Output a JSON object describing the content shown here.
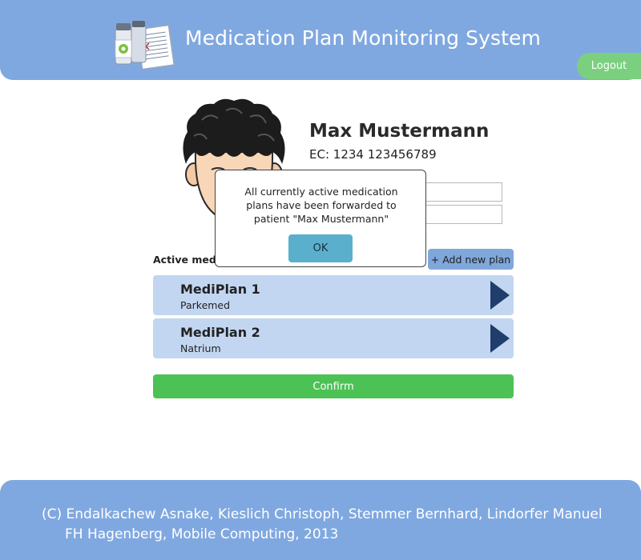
{
  "header": {
    "title": "Medication Plan Monitoring System",
    "logout_label": "Logout",
    "logo_icon": "medication-bottles-and-document"
  },
  "patient": {
    "name": "Max Mustermann",
    "ec": "EC: 1234 123456789",
    "avatar_icon": "cartoon-face-avatar"
  },
  "plans": {
    "section_label": "Active medi",
    "add_label": "+ Add new plan",
    "items": [
      {
        "title": "MediPlan 1",
        "subtitle": "Parkemed"
      },
      {
        "title": "MediPlan 2",
        "subtitle": "Natrium"
      }
    ]
  },
  "confirm_label": "Confirm",
  "dialog": {
    "message": "All currently active medication plans have been forwarded to patient \"Max Mustermann\"",
    "ok_label": "OK"
  },
  "footer": {
    "line1": "(C) Endalkachew Asnake, Kieslich Christoph, Stemmer Bernhard, Lindorfer Manuel",
    "line2": "FH Hagenberg, Mobile Computing, 2013"
  },
  "colors": {
    "header_bg": "#80a8e0",
    "logout_bg": "#7bd07f",
    "plan_bg": "#c2d6f1",
    "arrow": "#1f3e6c",
    "confirm_bg": "#4cc254",
    "ok_bg": "#5ab0cc"
  }
}
